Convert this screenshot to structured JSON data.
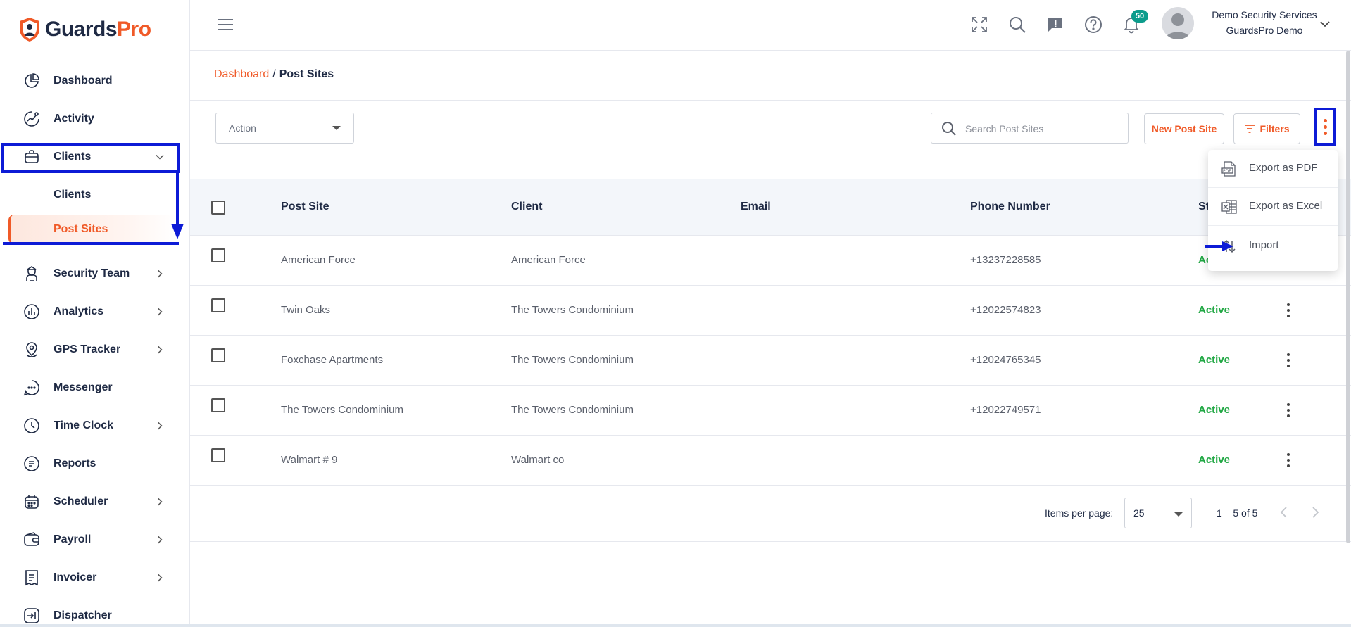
{
  "brand": {
    "name_part1": "Guards",
    "name_part2": "Pro",
    "accent": "#f05a28",
    "annotation_color": "#0d1bd6"
  },
  "sidebar": {
    "items": [
      {
        "label": "Dashboard",
        "icon": "dashboard-icon"
      },
      {
        "label": "Activity",
        "icon": "activity-icon"
      },
      {
        "label": "Clients",
        "icon": "briefcase-icon",
        "expanded": true
      },
      {
        "label": "Security Team",
        "icon": "security-team-icon"
      },
      {
        "label": "Analytics",
        "icon": "analytics-icon"
      },
      {
        "label": "GPS Tracker",
        "icon": "gps-icon"
      },
      {
        "label": "Messenger",
        "icon": "messenger-icon"
      },
      {
        "label": "Time Clock",
        "icon": "clock-icon"
      },
      {
        "label": "Reports",
        "icon": "reports-icon"
      },
      {
        "label": "Scheduler",
        "icon": "calendar-icon"
      },
      {
        "label": "Payroll",
        "icon": "wallet-icon"
      },
      {
        "label": "Invoicer",
        "icon": "invoice-icon"
      },
      {
        "label": "Dispatcher",
        "icon": "dispatcher-icon"
      }
    ],
    "sub_items": [
      {
        "label": "Clients"
      },
      {
        "label": "Post Sites",
        "active": true
      }
    ]
  },
  "topbar": {
    "notification_count": "50",
    "user_name": "Demo Security Services",
    "user_org": "GuardsPro Demo"
  },
  "breadcrumb": {
    "root": "Dashboard",
    "sep": "/",
    "current": "Post Sites"
  },
  "toolbar": {
    "action_label": "Action",
    "search_placeholder": "Search Post Sites",
    "new_button": "New Post Site",
    "filters_button": "Filters"
  },
  "table": {
    "headers": {
      "post_site": "Post Site",
      "client": "Client",
      "email": "Email",
      "phone": "Phone Number",
      "status": "St"
    },
    "rows": [
      {
        "post_site": "American Force",
        "client": "American Force",
        "email": "",
        "phone": "+13237228585",
        "status": "Ac"
      },
      {
        "post_site": "Twin Oaks",
        "client": "The Towers Condominium",
        "email": "",
        "phone": "+12022574823",
        "status": "Active"
      },
      {
        "post_site": "Foxchase Apartments",
        "client": "The Towers Condominium",
        "email": "",
        "phone": "+12024765345",
        "status": "Active"
      },
      {
        "post_site": "The Towers Condominium",
        "client": "The Towers Condominium",
        "email": "",
        "phone": "+12022749571",
        "status": "Active"
      },
      {
        "post_site": "Walmart # 9",
        "client": "Walmart co",
        "email": "",
        "phone": "",
        "status": "Active"
      }
    ]
  },
  "pagination": {
    "items_per_page_label": "Items per page:",
    "items_per_page": "25",
    "range": "1 – 5 of 5"
  },
  "more_menu": {
    "items": [
      {
        "label": "Export as PDF",
        "icon": "pdf-icon"
      },
      {
        "label": "Export as Excel",
        "icon": "excel-icon"
      },
      {
        "label": "Import",
        "icon": "import-icon"
      }
    ]
  }
}
